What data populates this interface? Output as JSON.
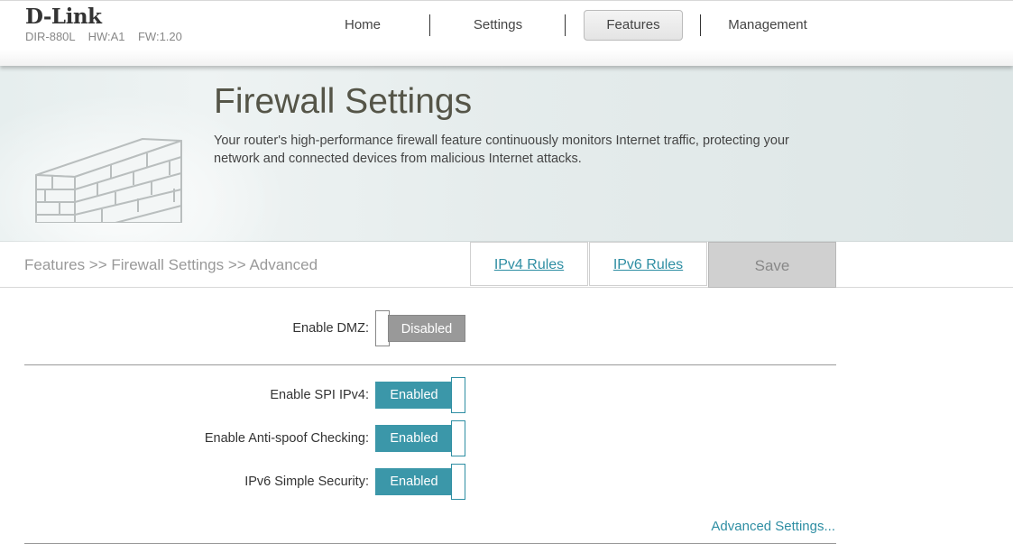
{
  "header": {
    "brand": "D-Link",
    "model": "DIR-880L    HW:A1    FW:1.20"
  },
  "nav": {
    "items": [
      {
        "label": "Home"
      },
      {
        "label": "Settings"
      },
      {
        "label": "Features",
        "active": true
      },
      {
        "label": "Management"
      }
    ]
  },
  "banner": {
    "title": "Firewall Settings",
    "description": "Your router's high-performance firewall feature continuously monitors Internet traffic, protecting your network and connected devices from malicious Internet attacks.",
    "icon": "brick-wall-icon"
  },
  "breadcrumb": "Features >> Firewall Settings >> Advanced",
  "tabs": {
    "ipv4": "IPv4 Rules",
    "ipv6": "IPv6 Rules",
    "save": "Save"
  },
  "settings": {
    "dmz": {
      "label": "Enable DMZ:",
      "state": "Disabled"
    },
    "spi": {
      "label": "Enable SPI IPv4:",
      "state": "Enabled"
    },
    "antispoof": {
      "label": "Enable Anti-spoof Checking:",
      "state": "Enabled"
    },
    "ipv6sec": {
      "label": "IPv6 Simple Security:",
      "state": "Enabled"
    }
  },
  "advanced_link": "Advanced Settings...",
  "colors": {
    "accent": "#3b97a9",
    "link": "#2e8ea3",
    "disabled": "#999999"
  }
}
